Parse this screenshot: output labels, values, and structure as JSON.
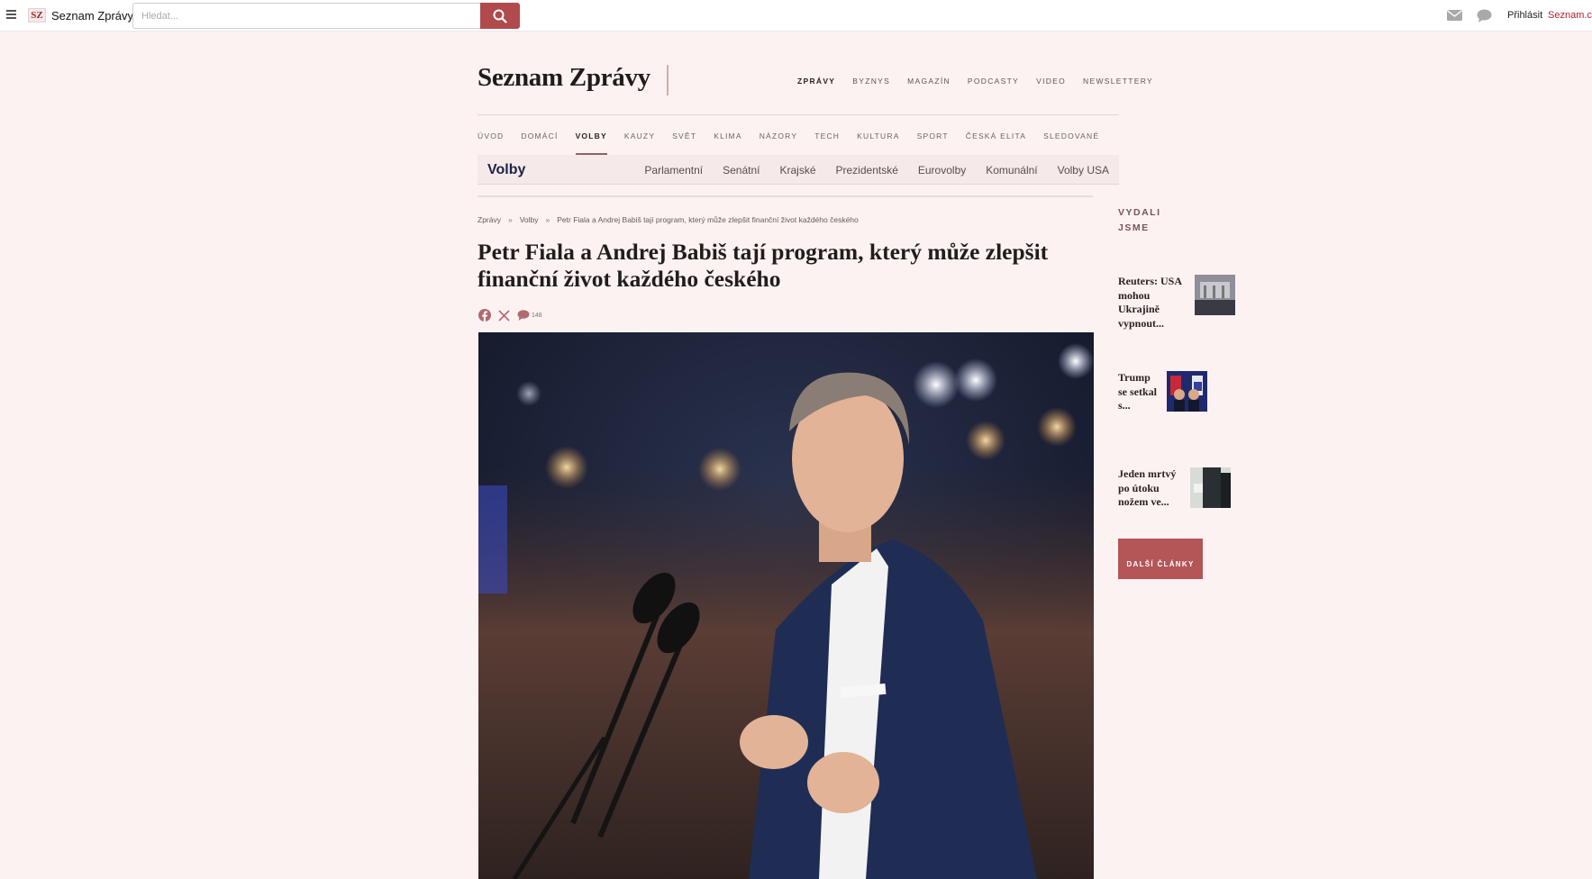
{
  "topbar": {
    "brand_logo": "SZ",
    "brand_name": "Seznam Zprávy",
    "search_placeholder": "Hledat...",
    "login": "Přihlásit",
    "seznam_link": "Seznam.cz",
    "icons": [
      "menu-icon",
      "search-icon",
      "mail-icon",
      "chat-icon"
    ]
  },
  "masthead": {
    "title": "Seznam Zprávy",
    "top_nav": [
      "ZPRÁVY",
      "BYZNYS",
      "MAGAZÍN",
      "PODCASTY",
      "VIDEO",
      "NEWSLETTERY"
    ],
    "top_nav_active": "ZPRÁVY"
  },
  "section_nav": {
    "items": [
      "ÚVOD",
      "DOMÁCÍ",
      "VOLBY",
      "KAUZY",
      "SVĚT",
      "KLIMA",
      "NÁZORY",
      "TECH",
      "KULTURA",
      "SPORT",
      "ČESKÁ ELITA",
      "SLEDOVANÉ"
    ],
    "active": "VOLBY"
  },
  "volby_bar": {
    "title": "Volby",
    "links": [
      "Parlamentní",
      "Senátní",
      "Krajské",
      "Prezidentské",
      "Eurovolby",
      "Komunální",
      "Volby USA"
    ]
  },
  "breadcrumb": {
    "items": [
      "Zprávy",
      "Volby",
      "Petr Fiala a Andrej Babiš tají program, který může zlepšit finanční život každého českého"
    ],
    "separator": "»"
  },
  "article": {
    "headline": "Petr Fiala a Andrej Babiš tají program, který může zlepšit finanční život každého českého",
    "comment_count": "148",
    "share_icons": [
      "facebook-icon",
      "x-icon",
      "comment-icon"
    ]
  },
  "sidebar": {
    "heading": "VYDALI JSME",
    "items": [
      {
        "title": "Reuters: USA mohou Ukrajině vypnout..."
      },
      {
        "title": "Trump se setkal s..."
      },
      {
        "title": "Jeden mrtvý po útoku nožem ve..."
      }
    ],
    "more_button": "DALŠÍ ČLÁNKY"
  },
  "colors": {
    "accent": "#b04a4d",
    "background": "#fdf2f2",
    "volby_title": "#1c2347"
  }
}
